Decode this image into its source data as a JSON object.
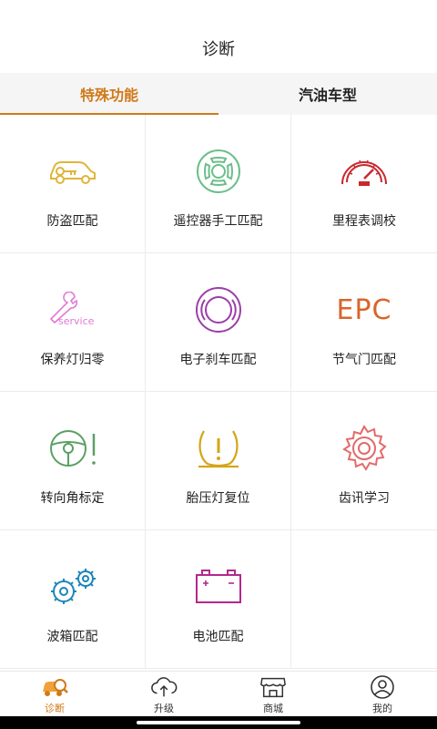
{
  "header": {
    "title": "诊断"
  },
  "tabs": [
    {
      "label": "特殊功能",
      "active": true
    },
    {
      "label": "汽油车型",
      "active": false
    }
  ],
  "functions": [
    {
      "label": "防盗匹配",
      "icon": "car-key-icon",
      "color": "#e0b53a"
    },
    {
      "label": "遥控器手工匹配",
      "icon": "remote-control-icon",
      "color": "#6bbf8a"
    },
    {
      "label": "里程表调校",
      "icon": "speedometer-icon",
      "color": "#c9282e"
    },
    {
      "label": "保养灯归零",
      "icon": "service-wrench-icon",
      "color": "#e07ad6",
      "icon_text": "service"
    },
    {
      "label": "电子刹车匹配",
      "icon": "brake-icon",
      "color": "#9b3fa8"
    },
    {
      "label": "节气门匹配",
      "icon": "epc-icon",
      "color": "#d9652a",
      "icon_text": "EPC"
    },
    {
      "label": "转向角标定",
      "icon": "steering-wheel-icon",
      "color": "#5aa063"
    },
    {
      "label": "胎压灯复位",
      "icon": "tire-pressure-icon",
      "color": "#d4a516"
    },
    {
      "label": "齿讯学习",
      "icon": "gear-icon",
      "color": "#e36a6a"
    },
    {
      "label": "波箱匹配",
      "icon": "gearbox-icon",
      "color": "#1c86b8"
    },
    {
      "label": "电池匹配",
      "icon": "battery-icon",
      "color": "#b3288f",
      "icon_text": "+  -"
    }
  ],
  "bottom_nav": [
    {
      "label": "诊断",
      "icon": "diagnosis-car-icon",
      "active": true
    },
    {
      "label": "升级",
      "icon": "cloud-upload-icon",
      "active": false
    },
    {
      "label": "商城",
      "icon": "store-icon",
      "active": false
    },
    {
      "label": "我的",
      "icon": "user-icon",
      "active": false
    }
  ],
  "colors": {
    "accent": "#d07a1a",
    "divider": "#ececec",
    "tab_bg": "#f5f5f5"
  }
}
